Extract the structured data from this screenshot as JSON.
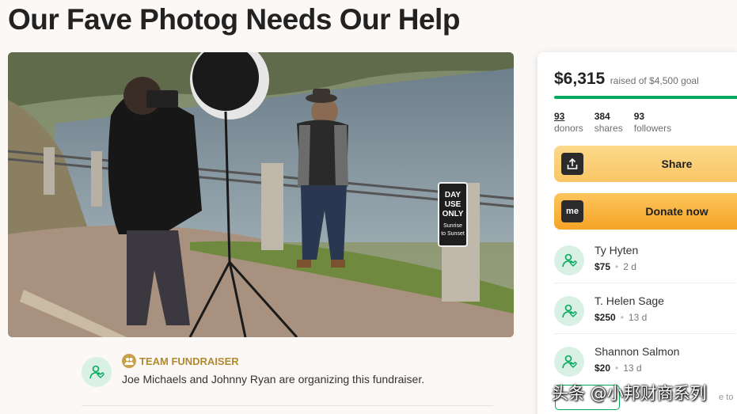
{
  "page": {
    "title": "Our Fave Photog Needs Our Help"
  },
  "hero": {
    "sign_lines": [
      "DAY",
      "USE",
      "ONLY",
      "Sunrise",
      "to Sunset"
    ]
  },
  "organizer": {
    "team_label": "TEAM FUNDRAISER",
    "text": "Joe Michaels and Johnny Ryan are organizing this fundraiser."
  },
  "sidebar": {
    "raised_amount": "$6,315",
    "raised_goal": "raised of $4,500 goal",
    "progress_fraction": 1.0,
    "stats": [
      {
        "num": "93",
        "label": "donors"
      },
      {
        "num": "384",
        "label": "shares"
      },
      {
        "num": "93",
        "label": "followers"
      }
    ],
    "share_label": "Share",
    "donate_label": "Donate now",
    "donate_icon_text": "me",
    "donors": [
      {
        "name": "Ty Hyten",
        "amount": "$75",
        "time": "2 d"
      },
      {
        "name": "T. Helen Sage",
        "amount": "$250",
        "time": "13 d"
      },
      {
        "name": "Shannon Salmon",
        "amount": "$20",
        "time": "13 d"
      }
    ],
    "cutoff_text": "e to"
  },
  "watermark": "头条 @小邦财商系列",
  "colors": {
    "brand_green": "#02a95c",
    "share_yellow": "#f9c665",
    "donate_orange": "#f6a425",
    "team_gold": "#b0892f"
  }
}
